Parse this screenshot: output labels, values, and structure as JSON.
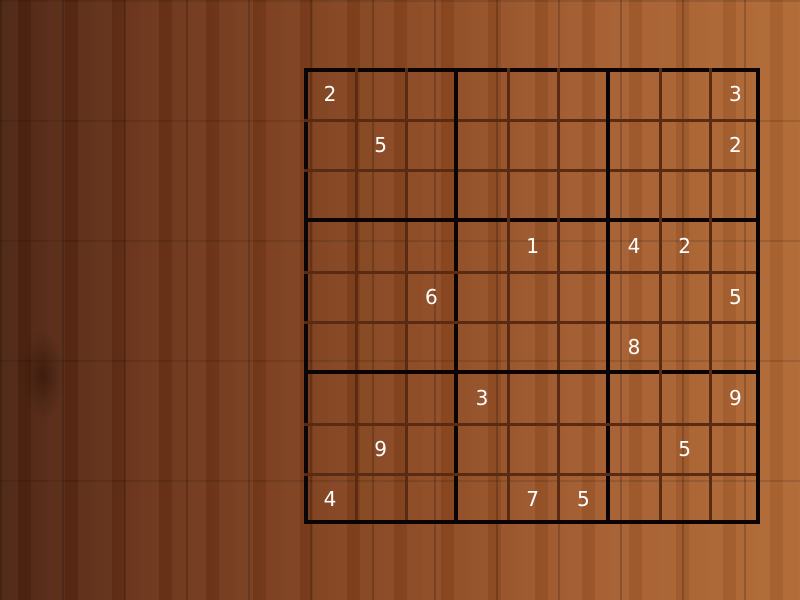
{
  "game": "Sudoku",
  "colors": {
    "digit": "#ffffff",
    "thin_line": "#5a2a12",
    "box_line": "#0a0504",
    "wood_dark": "#4a2210",
    "wood_light": "#b06833"
  },
  "grid": [
    [
      "2",
      "",
      "",
      "",
      "",
      "",
      "",
      "",
      "3"
    ],
    [
      "",
      "5",
      "",
      "",
      "",
      "",
      "",
      "",
      "2"
    ],
    [
      "",
      "",
      "",
      "",
      "",
      "",
      "",
      "",
      ""
    ],
    [
      "",
      "",
      "",
      "",
      "1",
      "",
      "4",
      "2",
      ""
    ],
    [
      "",
      "",
      "6",
      "",
      "",
      "",
      "",
      "",
      "5"
    ],
    [
      "",
      "",
      "",
      "",
      "",
      "",
      "8",
      "",
      ""
    ],
    [
      "",
      "",
      "",
      "3",
      "",
      "",
      "",
      "",
      "9"
    ],
    [
      "",
      "9",
      "",
      "",
      "",
      "",
      "",
      "5",
      ""
    ],
    [
      "4",
      "",
      "",
      "",
      "7",
      "5",
      "",
      "",
      ""
    ]
  ]
}
